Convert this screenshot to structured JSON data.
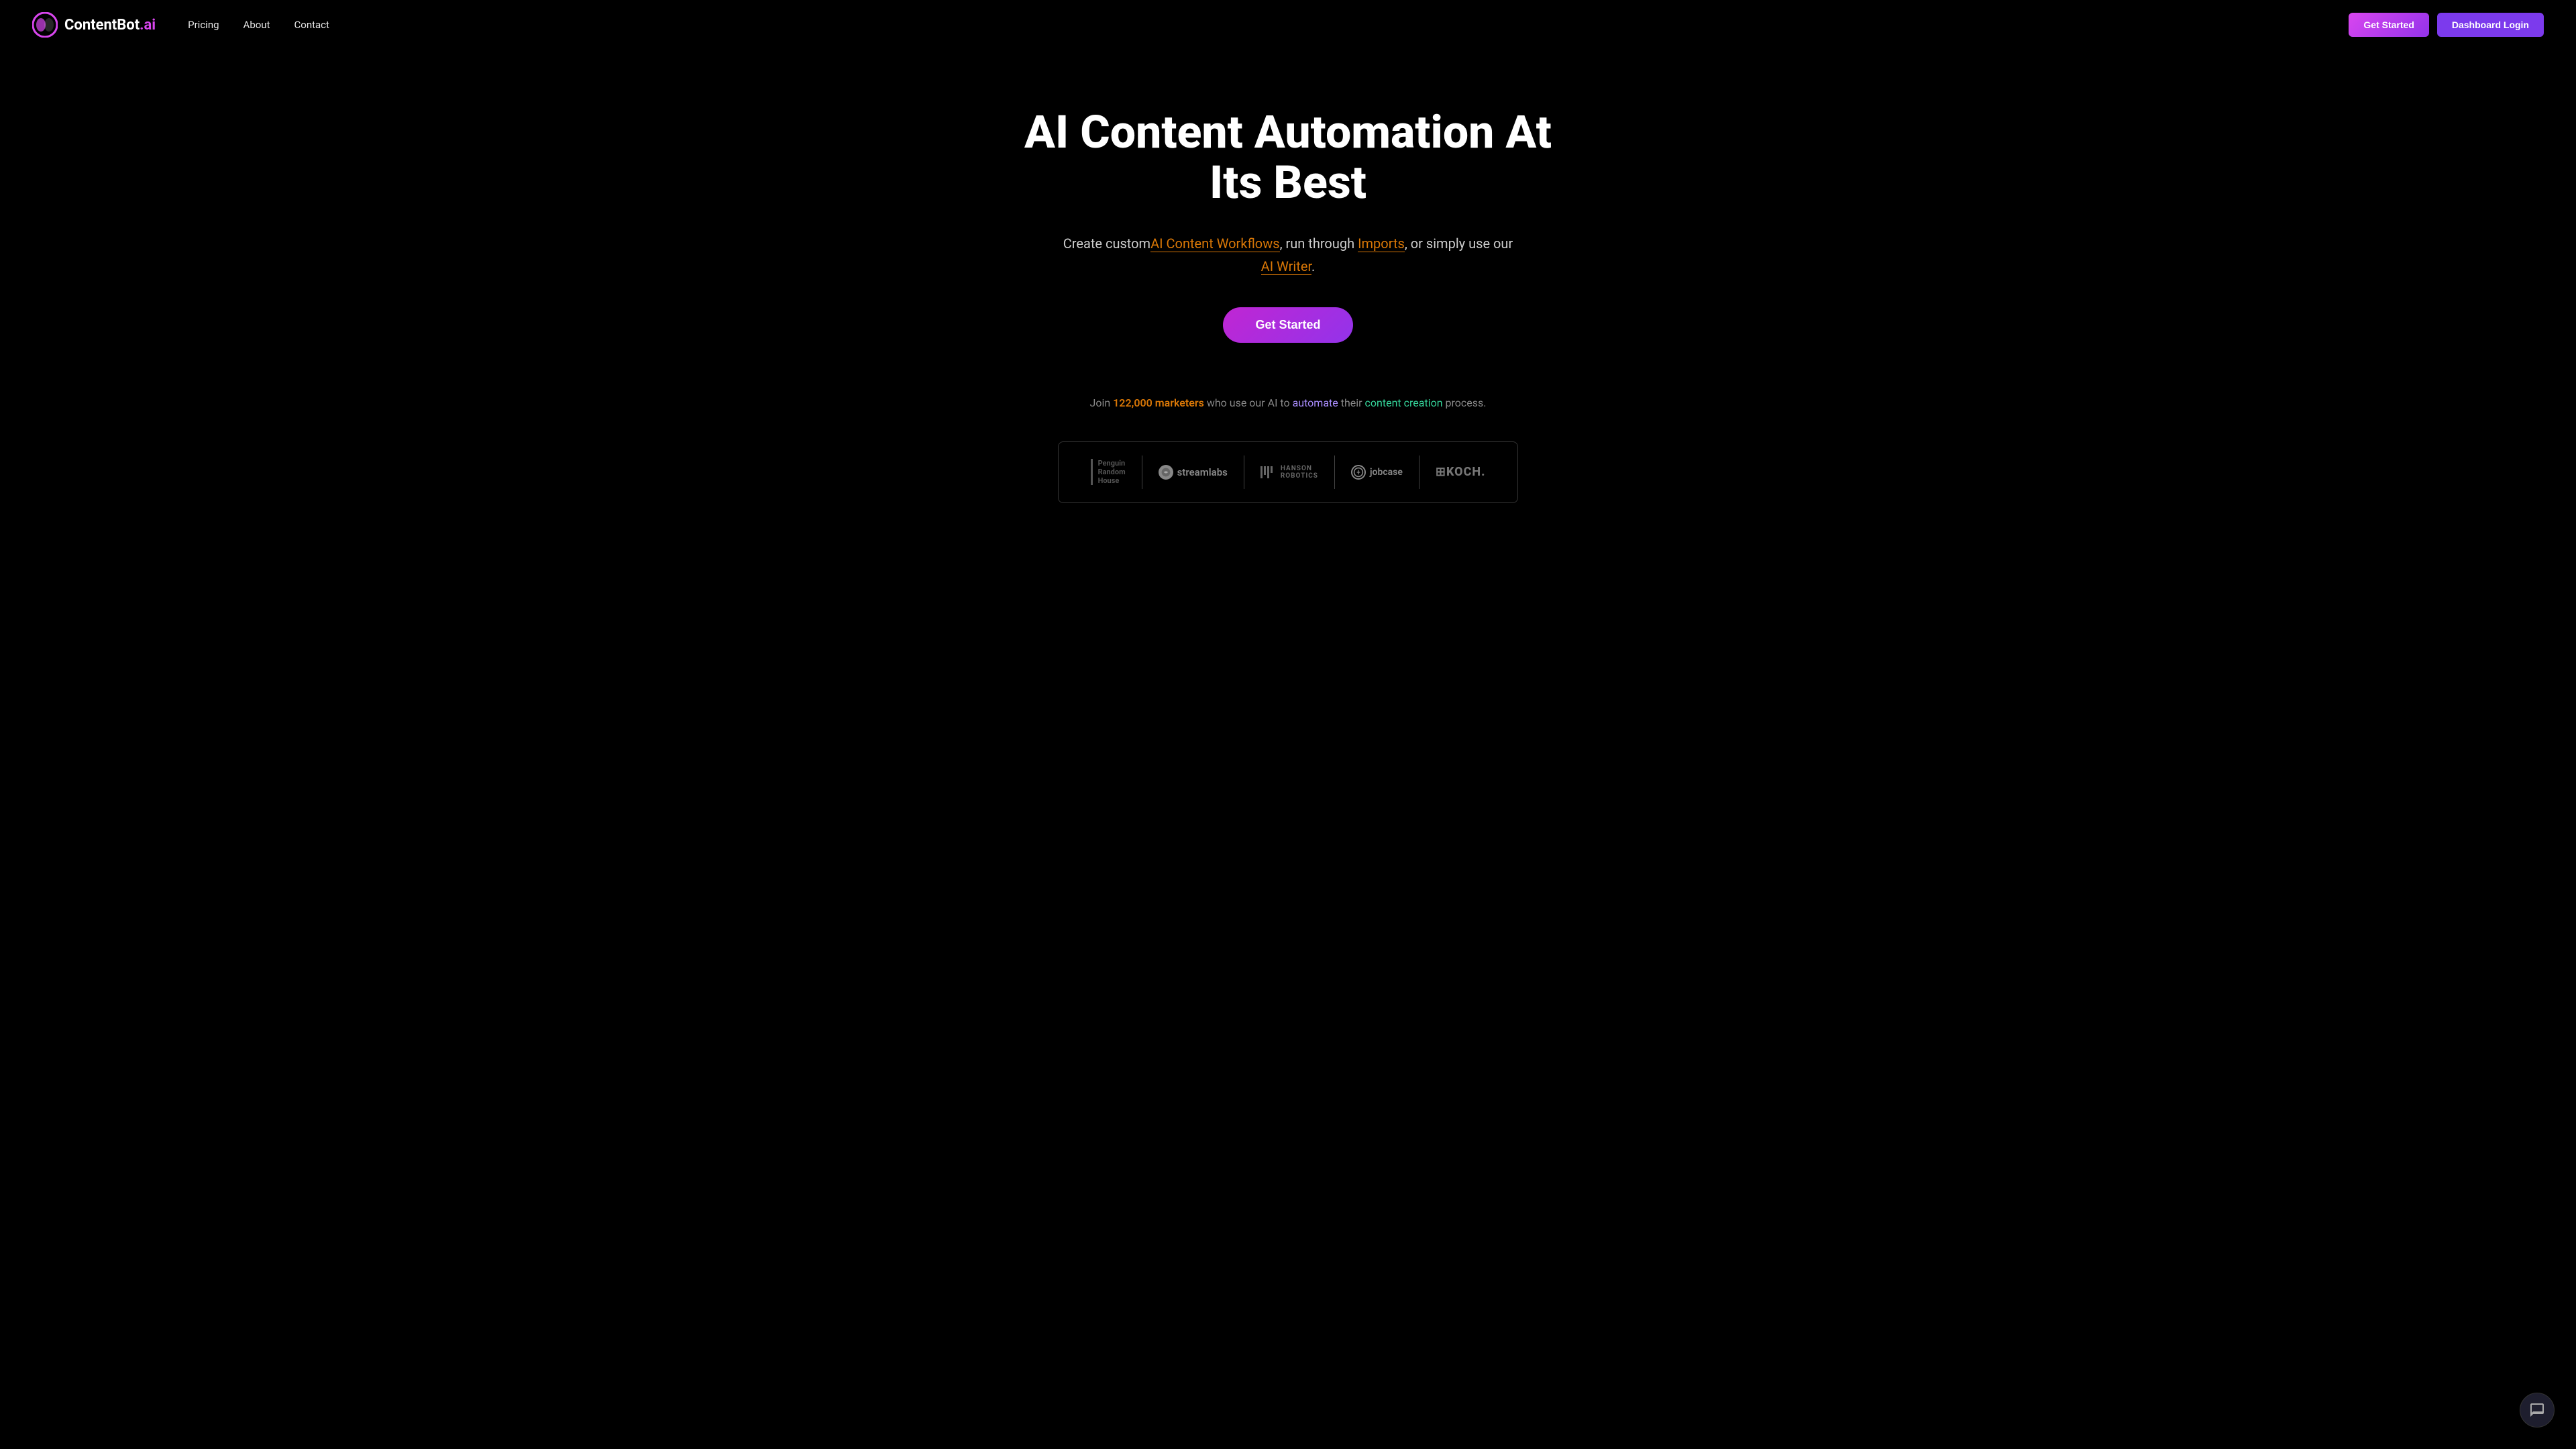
{
  "nav": {
    "logo_text": "ContentBot.ai",
    "links": [
      {
        "label": "Pricing",
        "id": "pricing"
      },
      {
        "label": "About",
        "id": "about"
      },
      {
        "label": "Contact",
        "id": "contact"
      }
    ],
    "btn_get_started": "Get Started",
    "btn_dashboard": "Dashboard Login"
  },
  "hero": {
    "title": "AI Content Automation At Its Best",
    "subtitle_before": "Create custom",
    "subtitle_workflows": "AI Content Workflows",
    "subtitle_mid1": ", run through",
    "subtitle_imports": "Imports",
    "subtitle_mid2": ", or simply use our",
    "subtitle_writer": "AI Writer",
    "subtitle_end": ".",
    "cta_label": "Get Started"
  },
  "social_proof": {
    "before": "Join",
    "marketers": "122,000 marketers",
    "mid": "who use our AI to",
    "automate": "automate",
    "mid2": "their",
    "content_creation": "content creation",
    "end": "process."
  },
  "logos": [
    {
      "id": "penguin",
      "name": "Penguin Random House"
    },
    {
      "id": "streamlabs",
      "name": "streamlabs"
    },
    {
      "id": "hanson",
      "name": "HANSON ROBOTICS"
    },
    {
      "id": "jobcase",
      "name": "jobcase"
    },
    {
      "id": "koch",
      "name": "KOCH."
    }
  ],
  "chat": {
    "icon": "chat"
  }
}
